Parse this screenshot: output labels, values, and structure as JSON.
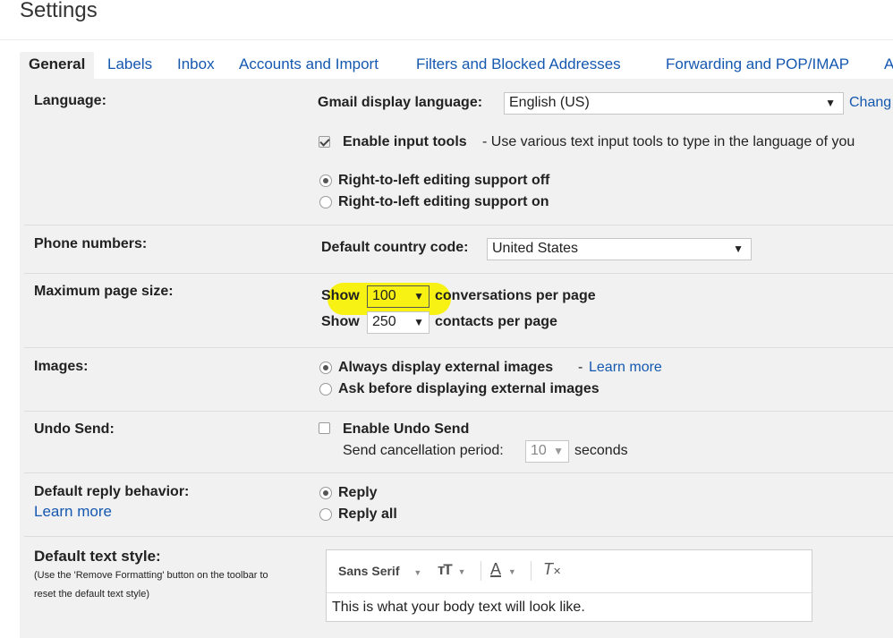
{
  "page": {
    "title": "Settings"
  },
  "tabs": [
    {
      "label": "General"
    },
    {
      "label": "Labels"
    },
    {
      "label": "Inbox"
    },
    {
      "label": "Accounts and Import"
    },
    {
      "label": "Filters and Blocked Addresses"
    },
    {
      "label": "Forwarding and POP/IMAP"
    },
    {
      "label": "A"
    }
  ],
  "language": {
    "label": "Language:",
    "display_language_label": "Gmail display language:",
    "display_language_value": "English (US)",
    "change_link": "Chang",
    "input_tools_label": "Enable input tools",
    "input_tools_desc": "- Use various text input tools to type in the language of you",
    "input_tools_checked": true,
    "rtl_off": "Right-to-left editing support off",
    "rtl_on": "Right-to-left editing support on",
    "rtl_selected": "off"
  },
  "phone": {
    "label": "Phone numbers:",
    "country_code_label": "Default country code:",
    "country_code_value": "United States"
  },
  "page_size": {
    "label": "Maximum page size:",
    "show_label": "Show",
    "conversations_value": "100",
    "conversations_suffix": "conversations per page",
    "contacts_value": "250",
    "contacts_suffix": "contacts per page",
    "highlight_color": "#f7f200"
  },
  "images": {
    "label": "Images:",
    "always_display": "Always display external images",
    "dash": "-",
    "learn_more": "Learn more",
    "ask_before": "Ask before displaying external images",
    "selected": "always"
  },
  "undo_send": {
    "label": "Undo Send:",
    "enable_label": "Enable Undo Send",
    "enabled": false,
    "period_label": "Send cancellation period:",
    "period_value": "10",
    "seconds_label": "seconds"
  },
  "reply": {
    "label": "Default reply behavior:",
    "learn_more": "Learn more",
    "reply": "Reply",
    "reply_all": "Reply all",
    "selected": "reply"
  },
  "text_style": {
    "label": "Default text style:",
    "note_line1": "(Use the 'Remove Formatting' button on the toolbar to",
    "note_line2": "reset the default text style)",
    "font_name": "Sans Serif",
    "preview": "This is what your body text will look like."
  },
  "colors": {
    "link": "#1558b0",
    "panel_bg": "#f1f1f1",
    "highlight": "#f7f200"
  }
}
